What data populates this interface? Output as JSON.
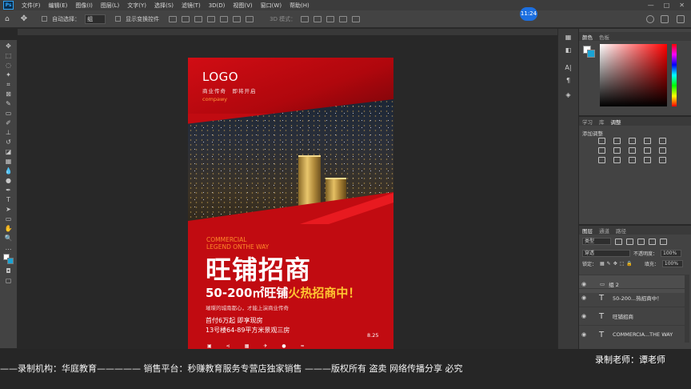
{
  "app": {
    "logo": "Ps"
  },
  "menu": [
    "文件(F)",
    "编辑(E)",
    "图像(I)",
    "图层(L)",
    "文字(Y)",
    "选择(S)",
    "滤镜(T)",
    "3D(D)",
    "视图(V)",
    "窗口(W)",
    "帮助(H)"
  ],
  "options": {
    "auto_select_label": "自动选择：",
    "auto_select_value": "组",
    "show_transform_label": "显示变换控件",
    "mode_3d_label": "3D 模式："
  },
  "timer": "11:24",
  "poster": {
    "logo": "LOGO",
    "slogan": "商业传奇　即将开启",
    "company": "compawy",
    "eng_line1": "COMMERCIAL",
    "eng_line2": "LEGEND ONTHE WAY",
    "title": "旺铺招商",
    "sub_white": "50-200㎡旺铺",
    "sub_yellow": "火热招商中！",
    "desc": "璀璨的城南都心，才能上演商业传奇",
    "info_line1": "首付6万起 即享现房",
    "info_line2": "13号楼64-89平方米景观三房",
    "date": "8.25"
  },
  "panels": {
    "color_tabs": [
      "颜色",
      "色板"
    ],
    "adjust_tabs": [
      "学习",
      "库",
      "调整"
    ],
    "adjust_label": "添加调整",
    "layer_tabs": [
      "图层",
      "通道",
      "路径"
    ],
    "filter_type": "类型",
    "blend_mode": "穿透",
    "opacity_label": "不透明度：",
    "opacity_value": "100%",
    "lock_label": "锁定：",
    "fill_label": "填充：",
    "fill_value": "100%",
    "layers": [
      {
        "name": "组 2",
        "kind": "group"
      },
      {
        "name": "50-200...热招商中！",
        "kind": "text"
      },
      {
        "name": "旺铺招商",
        "kind": "text"
      },
      {
        "name": "COMMERCIA...THE WAY",
        "kind": "text"
      }
    ]
  },
  "footer": {
    "caption": "——录制机构：华庭教育————— 销售平台：秒赚教育服务专营店独家销售 ———版权所有  盗卖  网络传播分享  必究",
    "teacher": "录制老师：谭老师"
  }
}
